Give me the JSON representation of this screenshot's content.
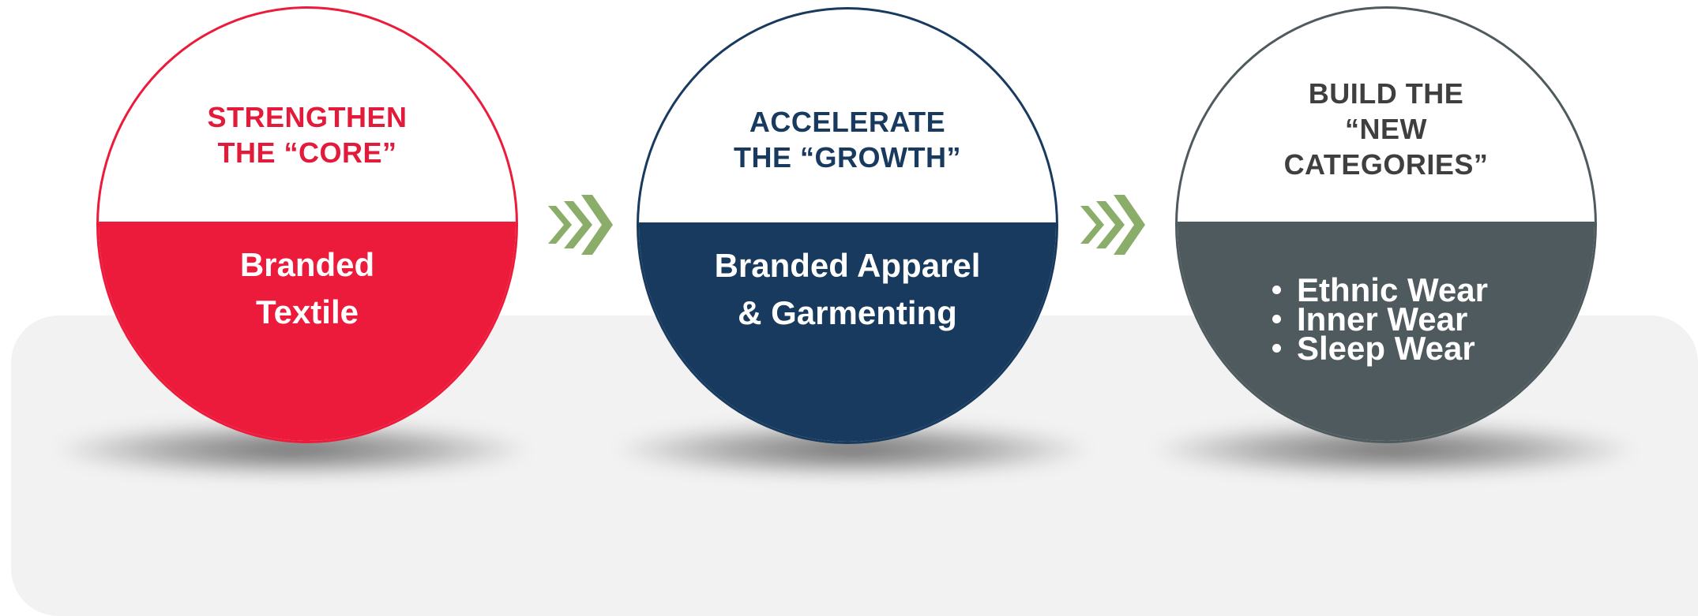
{
  "stages": [
    {
      "heading_lines": [
        "STRENGTHEN",
        "THE “CORE”"
      ],
      "body_lines": [
        "Branded",
        "Textile"
      ],
      "accent": "#ec1b3b",
      "heading_color": "#e31b3b"
    },
    {
      "heading_lines": [
        "ACCELERATE",
        "THE “GROWTH”"
      ],
      "body_lines": [
        "Branded Apparel",
        "& Garmenting"
      ],
      "accent": "#173a5e",
      "heading_color": "#173a5e"
    },
    {
      "heading_lines": [
        "BUILD THE",
        "“NEW",
        "CATEGORIES”"
      ],
      "bullets": [
        "Ethnic Wear",
        "Inner Wear",
        "Sleep Wear"
      ],
      "accent": "#4f5a5f",
      "heading_color": "#3f3f3f"
    }
  ],
  "connector": {
    "icon": "chevron-triple-right-icon",
    "color": "#8aad69"
  }
}
